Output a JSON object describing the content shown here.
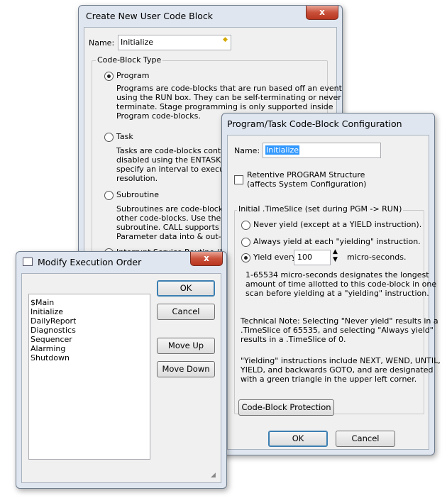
{
  "create_dialog": {
    "title": "Create New User Code Block",
    "close": "x",
    "name_label": "Name:",
    "name_value": "Initialize",
    "group_label": "Code-Block Type",
    "options": [
      {
        "label": "Program",
        "selected": true,
        "lines": [
          "Programs are code-blocks that are run based off an event",
          "using the RUN box. They can be self-terminating or never",
          "terminate.  Stage programming is only supported inside",
          "Program code-blocks."
        ]
      },
      {
        "label": "Task",
        "selected": false,
        "lines": [
          "Tasks are code-blocks containing",
          "disabled using the ENTASK box",
          "specify an interval to execute",
          "resolution."
        ]
      },
      {
        "label": "Subroutine",
        "selected": false,
        "lines": [
          "Subroutines are code-blocks th",
          "other code-blocks.  Use the CA",
          "subroutine.  CALL supports bas",
          "Parameter data into & out-of a"
        ]
      },
      {
        "label": "Interrupt Service Routine (ISR",
        "selected": false,
        "lines": []
      }
    ]
  },
  "order_dialog": {
    "title": "Modify Execution Order",
    "close": "x",
    "items": [
      "$Main",
      "Initialize",
      "DailyReport",
      "Diagnostics",
      "Sequencer",
      "Alarming",
      "Shutdown"
    ],
    "ok": "OK",
    "cancel": "Cancel",
    "move_up": "Move Up",
    "move_down": "Move Down"
  },
  "config_dialog": {
    "title": "Program/Task Code-Block Configuration",
    "name_label": "Name:",
    "name_value": "Initialize",
    "retentive_line1": "Retentive PROGRAM Structure",
    "retentive_line2": "(affects System Configuration)",
    "retentive_checked": false,
    "group_label": "Initial .TimeSlice (set during PGM -> RUN)",
    "never_yield": "Never yield (except at a YIELD instruction).",
    "always_yield": "Always yield at each \"yielding\" instruction.",
    "yield_every": "Yield every",
    "yield_value": "100",
    "micro_seconds": "micro-seconds.",
    "selected_option": "yield_every",
    "range_lines": [
      "1-65534 micro-seconds designates the longest",
      "amount of time allotted to this code-block in one",
      "scan before yielding at a \"yielding\" instruction."
    ],
    "tech_lines": [
      "Technical Note: Selecting \"Never yield\" results in a",
      ".TimeSlice of 65535, and selecting \"Always yield\"",
      "results in a .TimeSlice of 0."
    ],
    "yielding_lines": [
      "\"Yielding\" instructions include NEXT, WEND, UNTIL,",
      "YIELD, and backwards GOTO, and are designated",
      "with a green triangle in the upper left corner."
    ],
    "protection_button": "Code-Block Protection",
    "ok": "OK",
    "cancel": "Cancel"
  }
}
